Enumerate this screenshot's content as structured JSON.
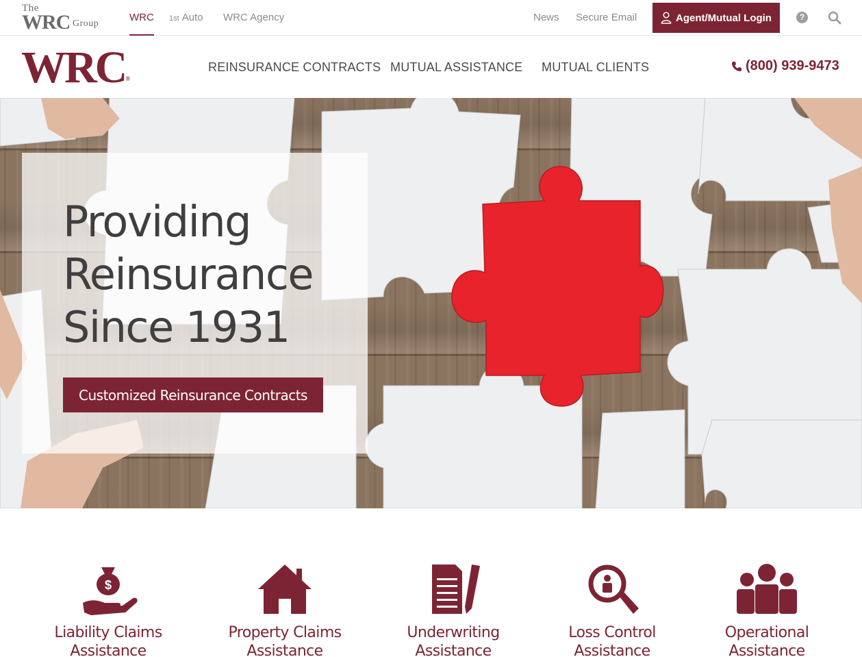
{
  "topbar": {
    "group_logo": {
      "the": "The",
      "wrc": "WRC",
      "group": "Group"
    },
    "links": {
      "wrc": "WRC",
      "first_auto_num": "1st",
      "first_auto_word": "Auto",
      "agency": "WRC Agency",
      "news": "News",
      "secure_email": "Secure Email"
    },
    "login_label": "Agent/Mutual Login",
    "help_glyph": "?"
  },
  "nav": {
    "logo_text": "WRC",
    "logo_mark": "®",
    "items": [
      "Reinsurance Contracts",
      "Mutual Assistance",
      "Mutual Clients"
    ],
    "phone": "(800) 939-9473"
  },
  "hero": {
    "title_lines": [
      "Providing",
      "Reinsurance",
      "Since 1931"
    ],
    "button_label": "Customized Reinsurance Contracts"
  },
  "services": [
    {
      "line1": "Liability Claims",
      "line2": "Assistance",
      "icon": "money-bag-hand-icon"
    },
    {
      "line1": "Property Claims",
      "line2": "Assistance",
      "icon": "house-icon"
    },
    {
      "line1": "Underwriting",
      "line2": "Assistance",
      "icon": "document-pencil-icon"
    },
    {
      "line1": "Loss Control",
      "line2": "Assistance",
      "icon": "magnifier-person-icon"
    },
    {
      "line1": "Operational",
      "line2": "Assistance",
      "icon": "team-icon"
    }
  ],
  "colors": {
    "brand": "#7d2434",
    "puzzle_red": "#e8232b",
    "muted_link": "#8a8a8a",
    "wood": "#7e6b58"
  }
}
